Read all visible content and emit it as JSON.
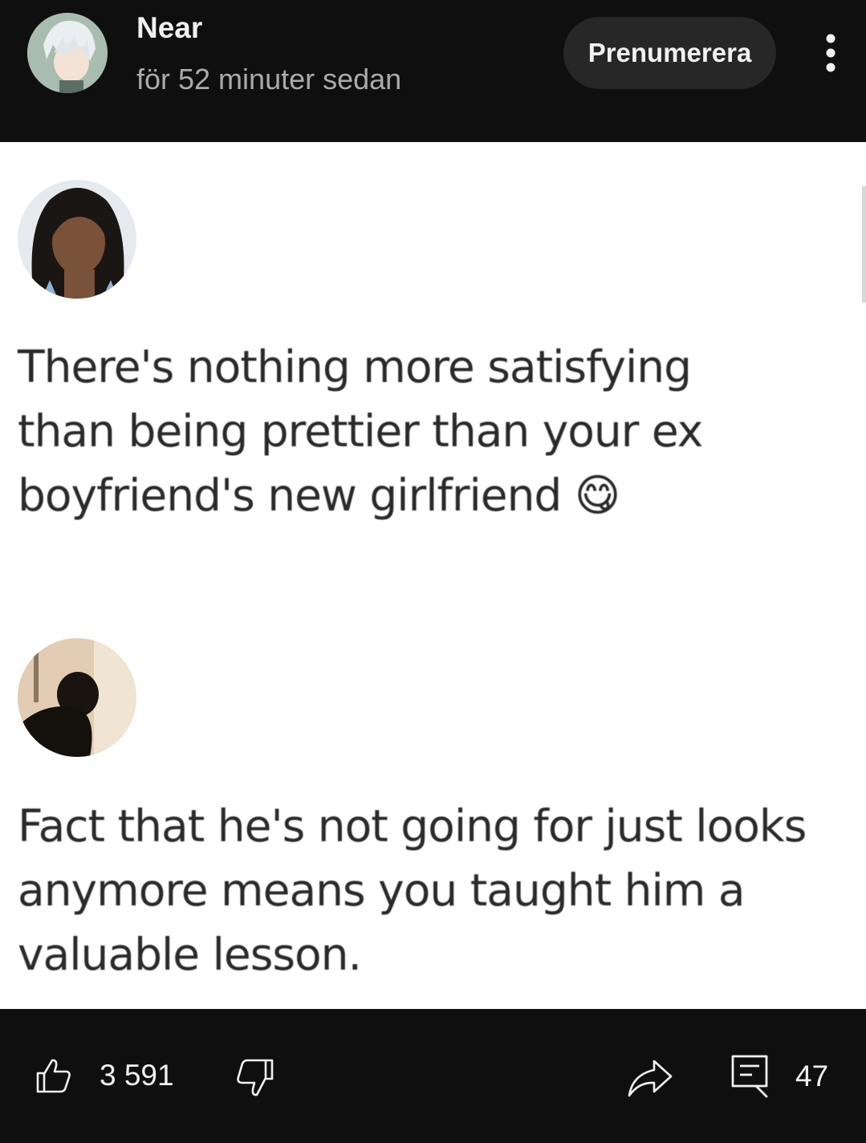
{
  "header": {
    "channel_name": "Near",
    "post_time": "för 52 minuter sedan",
    "subscribe_label": "Prenumerera",
    "avatar_icon": "anime-avatar-icon",
    "more_icon": "more-vertical-icon"
  },
  "post": {
    "tweets": [
      {
        "text": "There's nothing more satisfying\nthan being prettier than your ex\nboyfriend's new girlfriend",
        "emoji": "😋"
      },
      {
        "text": "Fact that he's not going for just looks\nanymore means you taught him a\nvaluable lesson."
      }
    ]
  },
  "actions": {
    "like_count": "3 591",
    "comment_count": "47",
    "like_icon": "thumbs-up-icon",
    "dislike_icon": "thumbs-down-icon",
    "share_icon": "share-icon",
    "comment_icon": "comment-icon"
  }
}
